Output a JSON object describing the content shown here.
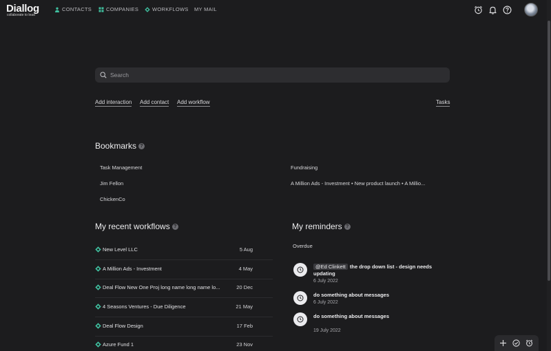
{
  "brand": {
    "name": "Diallog",
    "tagline": "collaborate to lead"
  },
  "nav": {
    "items": [
      {
        "label": "CONTACTS",
        "icon": "person-icon"
      },
      {
        "label": "COMPANIES",
        "icon": "grid-icon"
      },
      {
        "label": "WORKFLOWS",
        "icon": "diamond-icon"
      },
      {
        "label": "MY MAIL",
        "icon": ""
      }
    ],
    "right_icons": [
      "alarm-icon",
      "bell-icon",
      "help-icon",
      "avatar"
    ]
  },
  "search": {
    "placeholder": "Search"
  },
  "actions": {
    "add_interaction": "Add interaction",
    "add_contact": "Add contact",
    "add_workflow": "Add workflow",
    "tasks": "Tasks"
  },
  "bookmarks": {
    "title": "Bookmarks",
    "items": [
      "Task Management",
      "Fundraising",
      "Jim Fellon",
      "A Million Ads - Investment • New product launch • A Millio...",
      "ChickenCo"
    ]
  },
  "workflows": {
    "title": "My recent workflows",
    "rows": [
      {
        "name": "New Level LLC",
        "date": "5 Aug"
      },
      {
        "name": "A Million Ads - Investment",
        "date": "4 May"
      },
      {
        "name": "Deal Flow New One Proj long name long name lo...",
        "date": "20 Dec"
      },
      {
        "name": "4 Seasons Ventures - Due Diligence",
        "date": "21 May"
      },
      {
        "name": "Deal Flow Design",
        "date": "17 Feb"
      },
      {
        "name": "Azure Fund 1",
        "date": "23 Nov"
      }
    ]
  },
  "reminders": {
    "title": "My reminders",
    "overdue_label": "Overdue",
    "items": [
      {
        "mention": "@Ed Clinkett",
        "text": "the drop down list - design needs updating",
        "date": "6 July 2022"
      },
      {
        "mention": "",
        "text": "do something about messages",
        "date": "6 July 2022"
      },
      {
        "mention": "",
        "text": "do something about messages",
        "date": "19 July 2022"
      }
    ]
  },
  "colors": {
    "background": "#1c1c1e",
    "accent": "#3fbf9f",
    "surface": "#2d2d30"
  },
  "fab": {
    "icons": [
      "plus-icon",
      "check-circle-icon",
      "alarm-icon"
    ]
  }
}
